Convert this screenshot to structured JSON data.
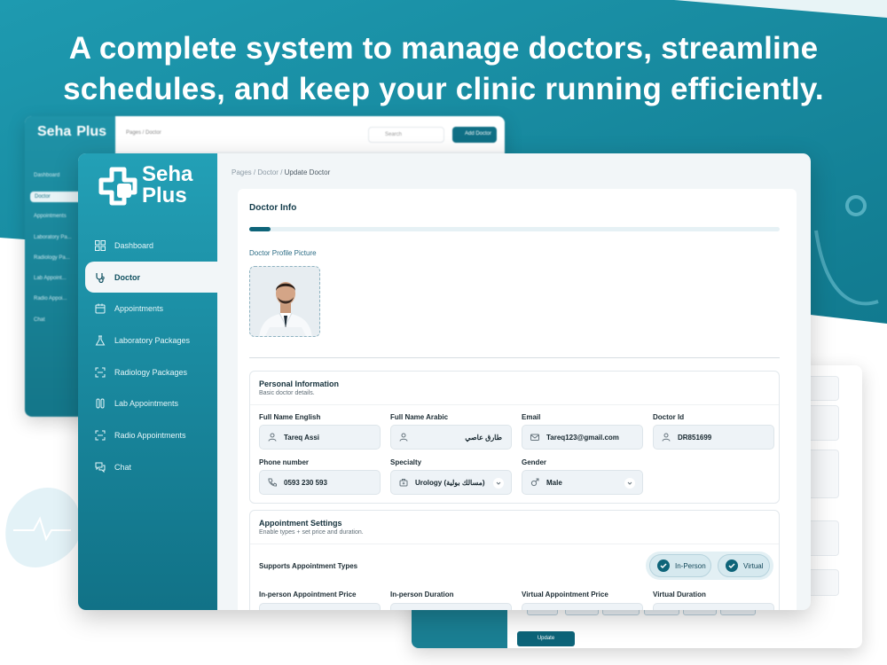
{
  "headline": {
    "line1": "A complete system to manage doctors, streamline",
    "line2": "schedules, and keep your clinic running efficiently."
  },
  "brand": {
    "name_line1": "Seha",
    "name_line2": "Plus"
  },
  "background_window": {
    "breadcrumb": "Pages / Doctor",
    "search_placeholder": "Search",
    "add_button": "Add Doctor",
    "nav": [
      "Dashboard",
      "Doctor",
      "Appointments",
      "Laboratory Pa...",
      "Radiology Pa...",
      "Lab Appoint...",
      "Radio Appoi...",
      "Chat"
    ]
  },
  "sidebar": {
    "items": [
      {
        "label": "Dashboard",
        "icon": "grid-icon",
        "active": false
      },
      {
        "label": "Doctor",
        "icon": "stethoscope-icon",
        "active": true
      },
      {
        "label": "Appointments",
        "icon": "calendar-icon",
        "active": false
      },
      {
        "label": "Laboratory Packages",
        "icon": "flask-icon",
        "active": false
      },
      {
        "label": "Radiology Packages",
        "icon": "scan-icon",
        "active": false
      },
      {
        "label": "Lab Appointments",
        "icon": "test-tubes-icon",
        "active": false
      },
      {
        "label": "Radio Appointments",
        "icon": "scan-icon",
        "active": false
      },
      {
        "label": "Chat",
        "icon": "chat-icon",
        "active": false
      }
    ]
  },
  "breadcrumb": {
    "root": "Pages",
    "parent": "Doctor",
    "current": "Update Doctor",
    "sep": "/"
  },
  "doctor_info": {
    "title": "Doctor Info",
    "progress": 0.04,
    "profile_picture_label": "Doctor Profile Picture"
  },
  "personal": {
    "title": "Personal Information",
    "subtitle": "Basic doctor details.",
    "full_name_en": {
      "label": "Full Name English",
      "value": "Tareq Assi"
    },
    "full_name_ar": {
      "label": "Full Name Arabic",
      "value": "طارق عاصي"
    },
    "email": {
      "label": "Email",
      "value": "Tareq123@gmail.com"
    },
    "doctor_id": {
      "label": "Doctor Id",
      "value": "DR851699"
    },
    "phone": {
      "label": "Phone number",
      "value": "0593 230 593"
    },
    "specialty": {
      "label": "Specialty",
      "value": "Urology (مسالك بولية)"
    },
    "gender": {
      "label": "Gender",
      "value": "Male"
    }
  },
  "appointment": {
    "title": "Appointment Settings",
    "subtitle": "Enable types + set price and duration.",
    "supports_label": "Supports Appointment Types",
    "type_in_person": "In-Person",
    "type_virtual": "Virtual",
    "in_person_price_label": "In-person Appointment Price",
    "in_person_duration_label": "In-person Duration",
    "virtual_price_label": "Virtual Appointment Price",
    "virtual_duration_label": "Virtual Duration"
  },
  "right_window": {
    "update_button": "Update"
  },
  "colors": {
    "primary": "#0e6479",
    "sidebar": "#1a8aa0",
    "accent": "#23a0b6"
  }
}
